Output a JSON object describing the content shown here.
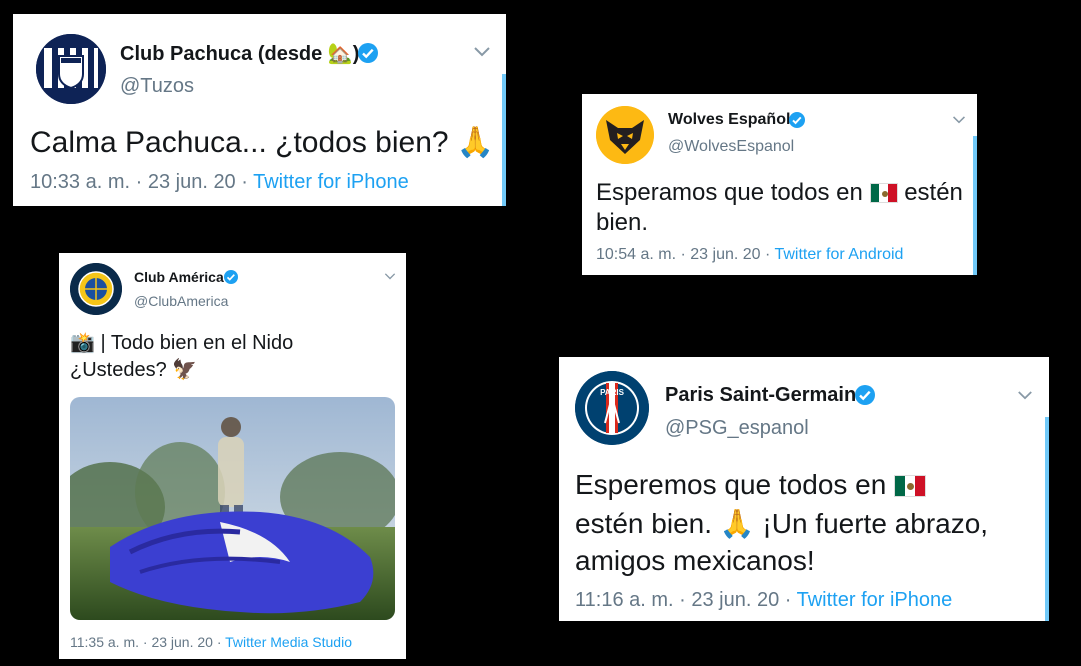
{
  "tweets": [
    {
      "name": "Club Pachuca (desde 🏡)",
      "handle": "@Tuzos",
      "text": "Calma Pachuca... ¿todos bien? 🙏",
      "time": "10:33 a. m. · 23 jun. 20 · ",
      "source": "Twitter for iPhone"
    },
    {
      "name": "Wolves Español",
      "handle": "@WolvesEspanol",
      "text_before": "Esperamos que todos en",
      "text_after": "estén bien.",
      "time": "10:54 a. m. · 23 jun. 20 · ",
      "source": "Twitter for Android"
    },
    {
      "name": "Club América",
      "handle": "@ClubAmerica",
      "text_line1": "📸 | Todo bien en el Nido",
      "text_line2": "¿Ustedes? 🦅",
      "time": "11:35 a. m. · 23 jun. 20 · ",
      "source": "Twitter Media Studio"
    },
    {
      "name": "Paris Saint-Germain",
      "handle": "@PSG_espanol",
      "text_line1": "Esperemos que todos en",
      "text_line2": "estén bien. 🙏 ¡Un fuerte abrazo,",
      "text_line3": "amigos mexicanos!",
      "time": "11:16 a. m. · 23 jun. 20 · ",
      "source": "Twitter for iPhone"
    }
  ],
  "colors": {
    "background": "#000000",
    "card": "#ffffff",
    "verified": "#1da1f2",
    "link": "#1da1f2",
    "secondary_text": "#657786"
  },
  "icons": [
    "verified-badge-icon",
    "chevron-down-icon",
    "mexico-flag-icon"
  ]
}
